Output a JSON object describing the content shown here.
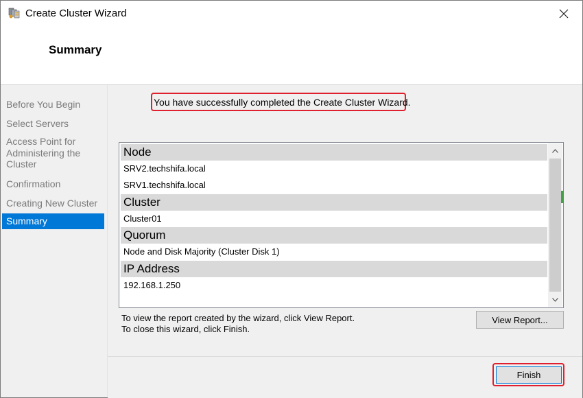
{
  "window": {
    "title": "Create Cluster Wizard",
    "icon": "cluster-wizard-icon"
  },
  "header": {
    "title": "Summary"
  },
  "nav": {
    "items": [
      {
        "label": "Before You Begin",
        "selected": false
      },
      {
        "label": "Select Servers",
        "selected": false
      },
      {
        "label": "Access Point for Administering the Cluster",
        "selected": false
      },
      {
        "label": "Confirmation",
        "selected": false
      },
      {
        "label": "Creating New Cluster",
        "selected": false
      },
      {
        "label": "Summary",
        "selected": true
      }
    ]
  },
  "main": {
    "success_message": "You have successfully completed the Create Cluster Wizard.",
    "report": {
      "sections": [
        {
          "heading": "Node",
          "rows": [
            "SRV2.techshifa.local",
            "SRV1.techshifa.local"
          ]
        },
        {
          "heading": "Cluster",
          "rows": [
            "Cluster01"
          ]
        },
        {
          "heading": "Quorum",
          "rows": [
            "Node and Disk Majority (Cluster Disk 1)"
          ]
        },
        {
          "heading": "IP Address",
          "rows": [
            "192.168.1.250"
          ]
        }
      ]
    },
    "help_line1": "To view the report created by the wizard, click View Report.",
    "help_line2": "To close this wizard, click Finish.",
    "view_report_label": "View Report..."
  },
  "footer": {
    "finish_label": "Finish"
  },
  "colors": {
    "accent": "#0078d7",
    "highlight": "#e0202e",
    "section_header": "#d9d9d9"
  }
}
